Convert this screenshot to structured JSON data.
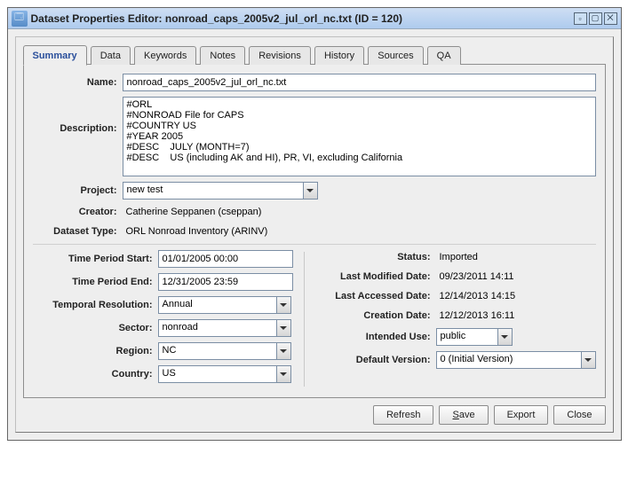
{
  "window": {
    "title": "Dataset Properties Editor: nonroad_caps_2005v2_jul_orl_nc.txt (ID = 120)"
  },
  "tabs": [
    "Summary",
    "Data",
    "Keywords",
    "Notes",
    "Revisions",
    "History",
    "Sources",
    "QA"
  ],
  "activeTab": "Summary",
  "summary": {
    "labels": {
      "name": "Name:",
      "description": "Description:",
      "project": "Project:",
      "creator": "Creator:",
      "datasetType": "Dataset Type:",
      "timeStart": "Time Period Start:",
      "timeEnd": "Time Period End:",
      "temporalResolution": "Temporal Resolution:",
      "sector": "Sector:",
      "region": "Region:",
      "country": "Country:",
      "status": "Status:",
      "lastModified": "Last Modified Date:",
      "lastAccessed": "Last Accessed Date:",
      "creationDate": "Creation Date:",
      "intendedUse": "Intended Use:",
      "defaultVersion": "Default Version:"
    },
    "name": "nonroad_caps_2005v2_jul_orl_nc.txt",
    "description": "#ORL\n#NONROAD File for CAPS\n#COUNTRY US\n#YEAR 2005\n#DESC    JULY (MONTH=7)\n#DESC    US (including AK and HI), PR, VI, excluding California",
    "project": "new test",
    "creator": "Catherine Seppanen (cseppan)",
    "datasetType": "ORL Nonroad Inventory (ARINV)",
    "timeStart": "01/01/2005 00:00",
    "timeEnd": "12/31/2005 23:59",
    "temporalResolution": "Annual",
    "sector": "nonroad",
    "region": "NC",
    "country": "US",
    "status": "Imported",
    "lastModified": "09/23/2011 14:11",
    "lastAccessed": "12/14/2013 14:15",
    "creationDate": "12/12/2013 16:11",
    "intendedUse": "public",
    "defaultVersion": "0 (Initial Version)"
  },
  "buttons": {
    "refresh": "Refresh",
    "save": "Save",
    "saveUnderline": "S",
    "saveRest": "ave",
    "export": "Export",
    "close": "Close"
  }
}
